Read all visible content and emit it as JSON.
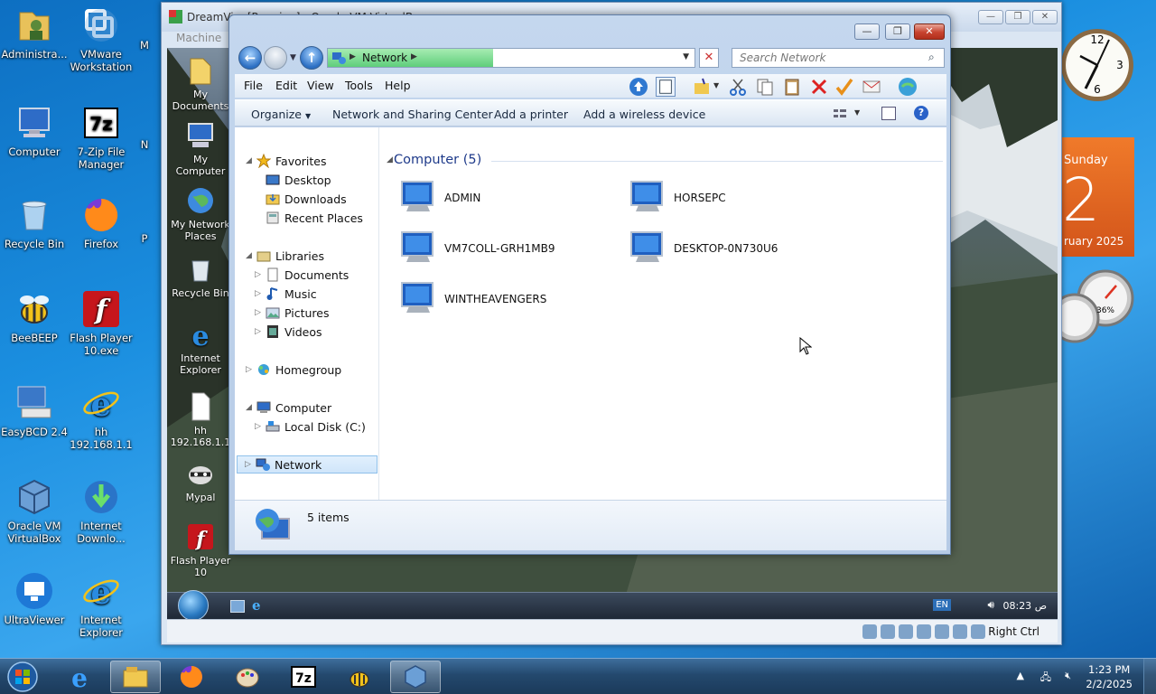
{
  "host_desktop": {
    "icons": [
      {
        "label": "Administra..."
      },
      {
        "label": "VMware Workstation"
      },
      {
        "label": "M"
      },
      {
        "label": "Computer"
      },
      {
        "label": "7-Zip File Manager"
      },
      {
        "label": "N"
      },
      {
        "label": "Recycle Bin"
      },
      {
        "label": "Firefox"
      },
      {
        "label": "P"
      },
      {
        "label": "BeeBEEP"
      },
      {
        "label": "Flash Player 10.exe"
      },
      {
        "label": "EasyBCD 2.4"
      },
      {
        "label": "hh 192.168.1.1"
      },
      {
        "label": "Oracle VM VirtualBox"
      },
      {
        "label": "Internet Downlo..."
      },
      {
        "label": "UltraViewer"
      },
      {
        "label": "Internet Explorer"
      }
    ]
  },
  "gadgets": {
    "calendar": {
      "day": "Sunday",
      "date": "2",
      "month": "ruary 2025"
    },
    "meter": {
      "percent": "36%"
    }
  },
  "host_taskbar": {
    "clock_time": "1:23 PM",
    "clock_date": "2/2/2025"
  },
  "vbox": {
    "title": "DreamVi... [Running] - Oracle VM VirtualBox",
    "menu": [
      "Machine"
    ],
    "host_key": "Right Ctrl",
    "controls": {
      "minimize": "—",
      "restore": "❐",
      "close": "✕"
    }
  },
  "guest": {
    "icons": [
      {
        "label": "My Documents"
      },
      {
        "label": "My Computer"
      },
      {
        "label": "My Network Places"
      },
      {
        "label": "Recycle Bin"
      },
      {
        "label": "Internet Explorer"
      },
      {
        "label": "hh 192.168.1.1"
      },
      {
        "label": "Mypal"
      },
      {
        "label": "Flash Player 10"
      }
    ],
    "taskbar": {
      "lang": "EN",
      "clock": "08:23 ص"
    }
  },
  "explorer": {
    "address": "Network",
    "address_progress": 0.45,
    "search_placeholder": "Search Network",
    "menu": [
      "File",
      "Edit",
      "View",
      "Tools",
      "Help"
    ],
    "commands": [
      "Organize",
      "Network and Sharing Center",
      "Add a printer",
      "Add a wireless device"
    ],
    "nav_tree": {
      "favorites": "Favorites",
      "favorites_items": [
        "Desktop",
        "Downloads",
        "Recent Places"
      ],
      "libraries": "Libraries",
      "libraries_items": [
        "Documents",
        "Music",
        "Pictures",
        "Videos"
      ],
      "homegroup": "Homegroup",
      "computer": "Computer",
      "computer_items": [
        "Local Disk (C:)"
      ],
      "network": "Network"
    },
    "group_header": "Computer (5)",
    "computers": [
      "ADMIN",
      "HORSEPC",
      "VM7COLL-GRH1MB9",
      "DESKTOP-0N730U6",
      "WINTHEAVENGERS"
    ],
    "status": "5 items"
  },
  "colors": {
    "accent": "#1e3a8a",
    "host_taskbar": "#24496e",
    "address_progress": "#5fce7b"
  }
}
